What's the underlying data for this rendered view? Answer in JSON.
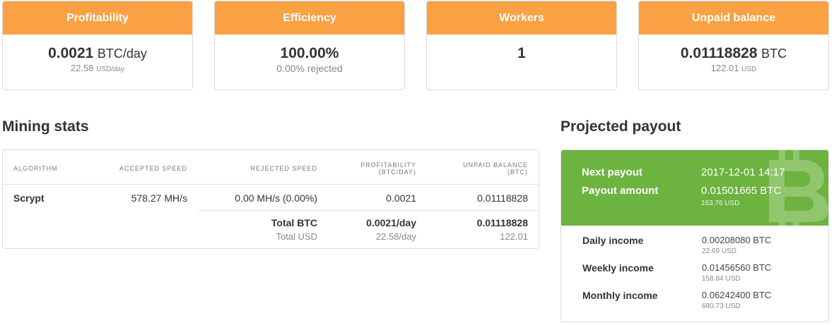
{
  "cards": [
    {
      "title": "Profitability",
      "value": "0.0021",
      "unit": "BTC/day",
      "sub_value": "22.58",
      "sub_unit": "USD/day"
    },
    {
      "title": "Efficiency",
      "value": "100.00%",
      "unit": "",
      "sub_value": "0.00% rejected",
      "sub_unit": ""
    },
    {
      "title": "Workers",
      "value": "1",
      "unit": "",
      "sub_value": "",
      "sub_unit": ""
    },
    {
      "title": "Unpaid balance",
      "value": "0.01118828",
      "unit": "BTC",
      "sub_value": "122.01",
      "sub_unit": "USD"
    }
  ],
  "mining_stats": {
    "title": "Mining stats",
    "headers": {
      "algorithm": "ALGORITHM",
      "accepted": "ACCEPTED SPEED",
      "rejected": "REJECTED SPEED",
      "profitability_1": "PROFITABILITY",
      "profitability_2": "(BTC/DAY)",
      "unpaid_1": "UNPAID BALANCE",
      "unpaid_2": "(BTC)"
    },
    "rows": [
      {
        "algorithm": "Scrypt",
        "accepted": "578.27 MH/s",
        "rejected": "0.00 MH/s (0.00%)",
        "profitability": "0.0021",
        "unpaid": "0.01118828"
      }
    ],
    "totals": {
      "btc_label": "Total BTC",
      "btc_profitability": "0.0021/day",
      "btc_unpaid": "0.01118828",
      "usd_label": "Total USD",
      "usd_profitability": "22.58/day",
      "usd_unpaid": "122.01"
    }
  },
  "projected_payout": {
    "title": "Projected payout",
    "next_payout_label": "Next payout",
    "next_payout_value": "2017-12-01 14:17",
    "payout_amount_label": "Payout amount",
    "payout_amount_value": "0.01501665 BTC",
    "payout_amount_usd": "163.76 USD",
    "income": [
      {
        "label": "Daily income",
        "btc": "0.00208080 BTC",
        "usd": "22.69 USD"
      },
      {
        "label": "Weekly income",
        "btc": "0.01456560 BTC",
        "usd": "158.84 USD"
      },
      {
        "label": "Monthly income",
        "btc": "0.06242400 BTC",
        "usd": "680.73 USD"
      }
    ]
  },
  "colors": {
    "accent": "#f9a143",
    "payout_green": "#6cb33f"
  },
  "icons": {
    "payout_watermark": "bitcoin-icon"
  }
}
